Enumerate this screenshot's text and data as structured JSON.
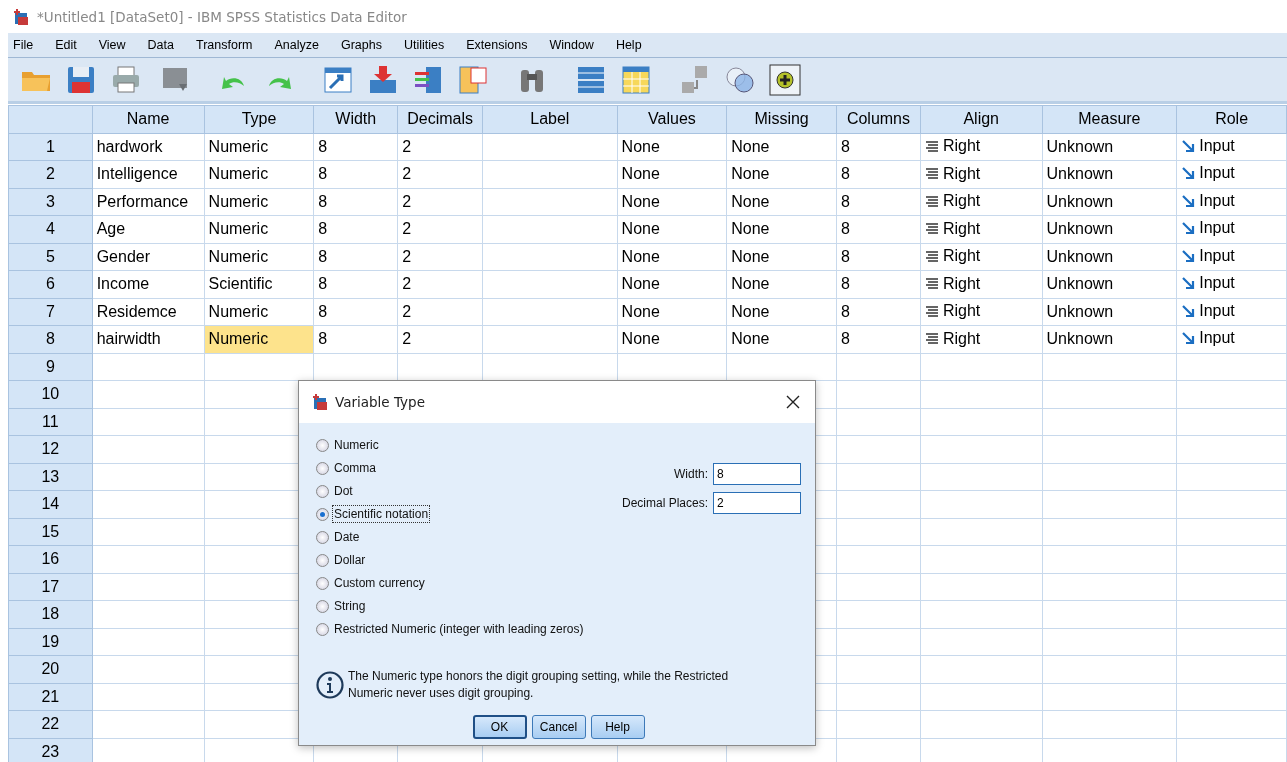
{
  "window": {
    "title": "*Untitled1 [DataSet0] - IBM SPSS Statistics Data Editor"
  },
  "menu": [
    "File",
    "Edit",
    "View",
    "Data",
    "Transform",
    "Analyze",
    "Graphs",
    "Utilities",
    "Extensions",
    "Window",
    "Help"
  ],
  "table": {
    "columns": [
      {
        "label": "Name",
        "kind": "text"
      },
      {
        "label": "Type",
        "kind": "text"
      },
      {
        "label": "Width",
        "kind": "text"
      },
      {
        "label": "Decimals",
        "kind": "text"
      },
      {
        "label": "Label",
        "kind": "text"
      },
      {
        "label": "Values",
        "kind": "text"
      },
      {
        "label": "Missing",
        "kind": "text"
      },
      {
        "label": "Columns",
        "kind": "text"
      },
      {
        "label": "Align",
        "kind": "align"
      },
      {
        "label": "Measure",
        "kind": "text"
      },
      {
        "label": "Role",
        "kind": "role"
      }
    ],
    "rows": [
      {
        "number": "1",
        "cells": [
          {
            "text": "hardwork",
            "selected": false
          },
          {
            "text": "Numeric",
            "selected": false
          },
          {
            "text": "8",
            "selected": false
          },
          {
            "text": "2",
            "selected": false
          },
          {
            "text": "",
            "selected": false
          },
          {
            "text": "None",
            "selected": false
          },
          {
            "text": "None",
            "selected": false
          },
          {
            "text": "8",
            "selected": false
          },
          {
            "text": "Right",
            "selected": false
          },
          {
            "text": "Unknown",
            "selected": false
          },
          {
            "text": "Input",
            "selected": false
          }
        ]
      },
      {
        "number": "2",
        "cells": [
          {
            "text": "Intelligence",
            "selected": false
          },
          {
            "text": "Numeric",
            "selected": false
          },
          {
            "text": "8",
            "selected": false
          },
          {
            "text": "2",
            "selected": false
          },
          {
            "text": "",
            "selected": false
          },
          {
            "text": "None",
            "selected": false
          },
          {
            "text": "None",
            "selected": false
          },
          {
            "text": "8",
            "selected": false
          },
          {
            "text": "Right",
            "selected": false
          },
          {
            "text": "Unknown",
            "selected": false
          },
          {
            "text": "Input",
            "selected": false
          }
        ]
      },
      {
        "number": "3",
        "cells": [
          {
            "text": "Performance",
            "selected": false
          },
          {
            "text": "Numeric",
            "selected": false
          },
          {
            "text": "8",
            "selected": false
          },
          {
            "text": "2",
            "selected": false
          },
          {
            "text": "",
            "selected": false
          },
          {
            "text": "None",
            "selected": false
          },
          {
            "text": "None",
            "selected": false
          },
          {
            "text": "8",
            "selected": false
          },
          {
            "text": "Right",
            "selected": false
          },
          {
            "text": "Unknown",
            "selected": false
          },
          {
            "text": "Input",
            "selected": false
          }
        ]
      },
      {
        "number": "4",
        "cells": [
          {
            "text": "Age",
            "selected": false
          },
          {
            "text": "Numeric",
            "selected": false
          },
          {
            "text": "8",
            "selected": false
          },
          {
            "text": "2",
            "selected": false
          },
          {
            "text": "",
            "selected": false
          },
          {
            "text": "None",
            "selected": false
          },
          {
            "text": "None",
            "selected": false
          },
          {
            "text": "8",
            "selected": false
          },
          {
            "text": "Right",
            "selected": false
          },
          {
            "text": "Unknown",
            "selected": false
          },
          {
            "text": "Input",
            "selected": false
          }
        ]
      },
      {
        "number": "5",
        "cells": [
          {
            "text": "Gender",
            "selected": false
          },
          {
            "text": "Numeric",
            "selected": false
          },
          {
            "text": "8",
            "selected": false
          },
          {
            "text": "2",
            "selected": false
          },
          {
            "text": "",
            "selected": false
          },
          {
            "text": "None",
            "selected": false
          },
          {
            "text": "None",
            "selected": false
          },
          {
            "text": "8",
            "selected": false
          },
          {
            "text": "Right",
            "selected": false
          },
          {
            "text": "Unknown",
            "selected": false
          },
          {
            "text": "Input",
            "selected": false
          }
        ]
      },
      {
        "number": "6",
        "cells": [
          {
            "text": "Income",
            "selected": false
          },
          {
            "text": "Scientific",
            "selected": false
          },
          {
            "text": "8",
            "selected": false
          },
          {
            "text": "2",
            "selected": false
          },
          {
            "text": "",
            "selected": false
          },
          {
            "text": "None",
            "selected": false
          },
          {
            "text": "None",
            "selected": false
          },
          {
            "text": "8",
            "selected": false
          },
          {
            "text": "Right",
            "selected": false
          },
          {
            "text": "Unknown",
            "selected": false
          },
          {
            "text": "Input",
            "selected": false
          }
        ]
      },
      {
        "number": "7",
        "cells": [
          {
            "text": "Residemce",
            "selected": false
          },
          {
            "text": "Numeric",
            "selected": false
          },
          {
            "text": "8",
            "selected": false
          },
          {
            "text": "2",
            "selected": false
          },
          {
            "text": "",
            "selected": false
          },
          {
            "text": "None",
            "selected": false
          },
          {
            "text": "None",
            "selected": false
          },
          {
            "text": "8",
            "selected": false
          },
          {
            "text": "Right",
            "selected": false
          },
          {
            "text": "Unknown",
            "selected": false
          },
          {
            "text": "Input",
            "selected": false
          }
        ]
      },
      {
        "number": "8",
        "cells": [
          {
            "text": "hairwidth",
            "selected": false
          },
          {
            "text": "Numeric",
            "selected": true
          },
          {
            "text": "8",
            "selected": false
          },
          {
            "text": "2",
            "selected": false
          },
          {
            "text": "",
            "selected": false
          },
          {
            "text": "None",
            "selected": false
          },
          {
            "text": "None",
            "selected": false
          },
          {
            "text": "8",
            "selected": false
          },
          {
            "text": "Right",
            "selected": false
          },
          {
            "text": "Unknown",
            "selected": false
          },
          {
            "text": "Input",
            "selected": false
          }
        ]
      }
    ],
    "empty_rows": [
      "9",
      "10",
      "11",
      "12",
      "13",
      "14",
      "15",
      "16",
      "17",
      "18",
      "19",
      "20",
      "21",
      "22",
      "23"
    ]
  },
  "dialog": {
    "title": "Variable Type",
    "options": [
      {
        "label": "Numeric",
        "selected": false,
        "focused": false
      },
      {
        "label": "Comma",
        "selected": false,
        "focused": false
      },
      {
        "label": "Dot",
        "selected": false,
        "focused": false
      },
      {
        "label": "Scientific notation",
        "selected": true,
        "focused": true
      },
      {
        "label": "Date",
        "selected": false,
        "focused": false
      },
      {
        "label": "Dollar",
        "selected": false,
        "focused": false
      },
      {
        "label": "Custom currency",
        "selected": false,
        "focused": false
      },
      {
        "label": "String",
        "selected": false,
        "focused": false
      },
      {
        "label": "Restricted Numeric (integer with leading zeros)",
        "selected": false,
        "focused": false
      }
    ],
    "fields": [
      {
        "label": "Width:",
        "value": "8"
      },
      {
        "label": "Decimal Places:",
        "value": "2"
      }
    ],
    "info": "The Numeric type honors the digit grouping setting, while the Restricted Numeric never uses digit grouping.",
    "buttons": [
      {
        "label": "OK",
        "default": true
      },
      {
        "label": "Cancel",
        "default": false
      },
      {
        "label": "Help",
        "default": false
      }
    ]
  }
}
